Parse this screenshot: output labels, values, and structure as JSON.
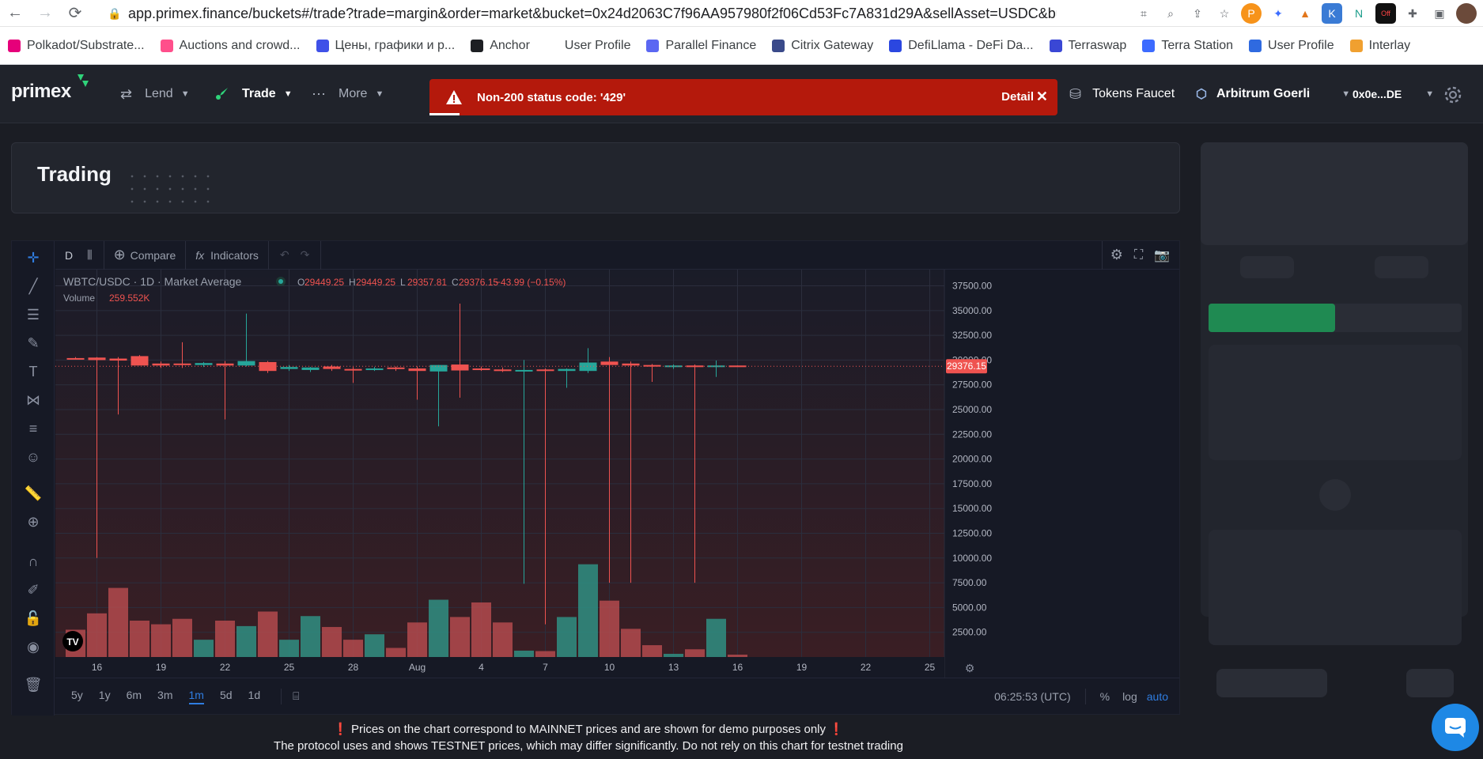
{
  "browser": {
    "url": "app.primex.finance/buckets#/trade?trade=margin&order=market&bucket=0x24d2063C7f96AA957980f2f06Cd53Fc7A831d29A&sellAsset=USDC&bu...",
    "bookmarks": [
      {
        "label": "Polkadot/Substrate...",
        "color": "#e6007a"
      },
      {
        "label": "Auctions and crowd...",
        "color": "#ff4f8b"
      },
      {
        "label": "Цены, графики и р...",
        "color": "#3f51e8"
      },
      {
        "label": "Anchor",
        "color": "#1d1f23"
      },
      {
        "label": "User Profile",
        "color": "#ffffff"
      },
      {
        "label": "Parallel Finance",
        "color": "#5b67f2"
      },
      {
        "label": "Citrix Gateway",
        "color": "#3a4a8a"
      },
      {
        "label": "DefiLlama - DeFi Da...",
        "color": "#2b47e0"
      },
      {
        "label": "Terraswap",
        "color": "#3a47d5"
      },
      {
        "label": "Terra Station",
        "color": "#3c6bff"
      },
      {
        "label": "User Profile",
        "color": "#2f6ae0"
      },
      {
        "label": "Interlay",
        "color": "#f0a030"
      }
    ],
    "extensions": [
      "P",
      "✦",
      "🦊",
      "K",
      "N",
      "Off",
      "✚",
      "▣",
      "👤"
    ]
  },
  "nav": {
    "logo": "primex",
    "lend": "Lend",
    "trade": "Trade",
    "more": "More",
    "tokens_faucet": "Tokens Faucet",
    "network": "Arbitrum Goerli",
    "wallet": "0x0e...DE"
  },
  "toast": {
    "message": "Non-200 status code: '429'",
    "detail": "Detail"
  },
  "trading": {
    "title": "Trading"
  },
  "chart_toolbar": {
    "interval": "D",
    "compare": "Compare",
    "indicators": "Indicators"
  },
  "chart_legend": {
    "symbol": "WBTC/USDC · 1D · Market Average",
    "o_label": "O",
    "o": "29449.25",
    "h_label": "H",
    "h": "29449.25",
    "l_label": "L",
    "l": "29357.81",
    "c_label": "C",
    "c": "29376.15",
    "change": "−43.99 (−0.15%)",
    "volume_label": "Volume",
    "volume": "259.552K",
    "last_price": "29376.15"
  },
  "chart_data": {
    "type": "candlestick",
    "title": "WBTC/USDC · 1D · Market Average",
    "y_ticks": [
      "37500.00",
      "35000.00",
      "32500.00",
      "30000.00",
      "27500.00",
      "25000.00",
      "22500.00",
      "20000.00",
      "17500.00",
      "15000.00",
      "12500.00",
      "10000.00",
      "7500.00",
      "5000.00",
      "2500.00"
    ],
    "x_ticks": [
      "16",
      "19",
      "22",
      "25",
      "28",
      "Aug",
      "4",
      "7",
      "10",
      "13",
      "16",
      "19",
      "22",
      "25"
    ],
    "ylim": [
      0,
      38500
    ],
    "candles": [
      {
        "o": 30200,
        "h": 30300,
        "l": 30100,
        "c": 30100,
        "v": 3000
      },
      {
        "o": 30250,
        "h": 30300,
        "l": 10000,
        "c": 30000,
        "v": 4800
      },
      {
        "o": 30150,
        "h": 30300,
        "l": 24500,
        "c": 29950,
        "v": 7600
      },
      {
        "o": 30400,
        "h": 30500,
        "l": 29500,
        "c": 29450,
        "v": 4000
      },
      {
        "o": 29650,
        "h": 29850,
        "l": 29200,
        "c": 29450,
        "v": 3600
      },
      {
        "o": 29650,
        "h": 31800,
        "l": 29200,
        "c": 29500,
        "v": 4200
      },
      {
        "o": 29500,
        "h": 29800,
        "l": 29300,
        "c": 29700,
        "v": 1900
      },
      {
        "o": 29650,
        "h": 29900,
        "l": 24000,
        "c": 29450,
        "v": 4000
      },
      {
        "o": 29450,
        "h": 34700,
        "l": 29350,
        "c": 29900,
        "v": 3400
      },
      {
        "o": 29800,
        "h": 29900,
        "l": 28700,
        "c": 28900,
        "v": 5000
      },
      {
        "o": 29100,
        "h": 29500,
        "l": 28900,
        "c": 29300,
        "v": 1900
      },
      {
        "o": 29000,
        "h": 29300,
        "l": 28800,
        "c": 29250,
        "v": 4500
      },
      {
        "o": 29350,
        "h": 29500,
        "l": 28900,
        "c": 29100,
        "v": 3300
      },
      {
        "o": 29100,
        "h": 29300,
        "l": 27700,
        "c": 29050,
        "v": 1900
      },
      {
        "o": 29100,
        "h": 29300,
        "l": 28900,
        "c": 29150,
        "v": 2500
      },
      {
        "o": 29250,
        "h": 29350,
        "l": 28900,
        "c": 29100,
        "v": 1000
      },
      {
        "o": 29150,
        "h": 29350,
        "l": 26000,
        "c": 28900,
        "v": 3800
      },
      {
        "o": 28850,
        "h": 29500,
        "l": 23300,
        "c": 29500,
        "v": 6300
      },
      {
        "o": 29550,
        "h": 35700,
        "l": 26200,
        "c": 28950,
        "v": 4400
      },
      {
        "o": 29150,
        "h": 29350,
        "l": 28900,
        "c": 29050,
        "v": 6000
      },
      {
        "o": 29050,
        "h": 29250,
        "l": 28800,
        "c": 28900,
        "v": 3800
      },
      {
        "o": 28900,
        "h": 30000,
        "l": 7400,
        "c": 29000,
        "v": 700
      },
      {
        "o": 29050,
        "h": 29150,
        "l": 3300,
        "c": 28900,
        "v": 650
      },
      {
        "o": 28900,
        "h": 29150,
        "l": 27200,
        "c": 29100,
        "v": 4400
      },
      {
        "o": 28900,
        "h": 31200,
        "l": 28700,
        "c": 29750,
        "v": 10200
      },
      {
        "o": 29850,
        "h": 30300,
        "l": 7500,
        "c": 29500,
        "v": 6200
      },
      {
        "o": 29650,
        "h": 29850,
        "l": 7500,
        "c": 29450,
        "v": 3100
      },
      {
        "o": 29500,
        "h": 29600,
        "l": 27800,
        "c": 29350,
        "v": 1300
      },
      {
        "o": 29350,
        "h": 29550,
        "l": 29100,
        "c": 29450,
        "v": 350
      },
      {
        "o": 29450,
        "h": 29550,
        "l": 7500,
        "c": 29350,
        "v": 850
      },
      {
        "o": 29350,
        "h": 29950,
        "l": 28300,
        "c": 29450,
        "v": 4200
      },
      {
        "o": 29449.25,
        "h": 29449.25,
        "l": 29357.81,
        "c": 29376.15,
        "v": 260
      }
    ]
  },
  "chart_bottom": {
    "periods": [
      "5y",
      "1y",
      "6m",
      "3m",
      "1m",
      "5d",
      "1d"
    ],
    "active_period": "1m",
    "time": "06:25:53 (UTC)",
    "percent": "%",
    "log": "log",
    "auto": "auto"
  },
  "notice": {
    "line1": "Prices on the chart correspond to MAINNET prices and are shown for demo purposes only",
    "line2": "The protocol uses and shows TESTNET prices, which may differ significantly. Do not rely on this chart for testnet trading",
    "mark": "❗"
  }
}
